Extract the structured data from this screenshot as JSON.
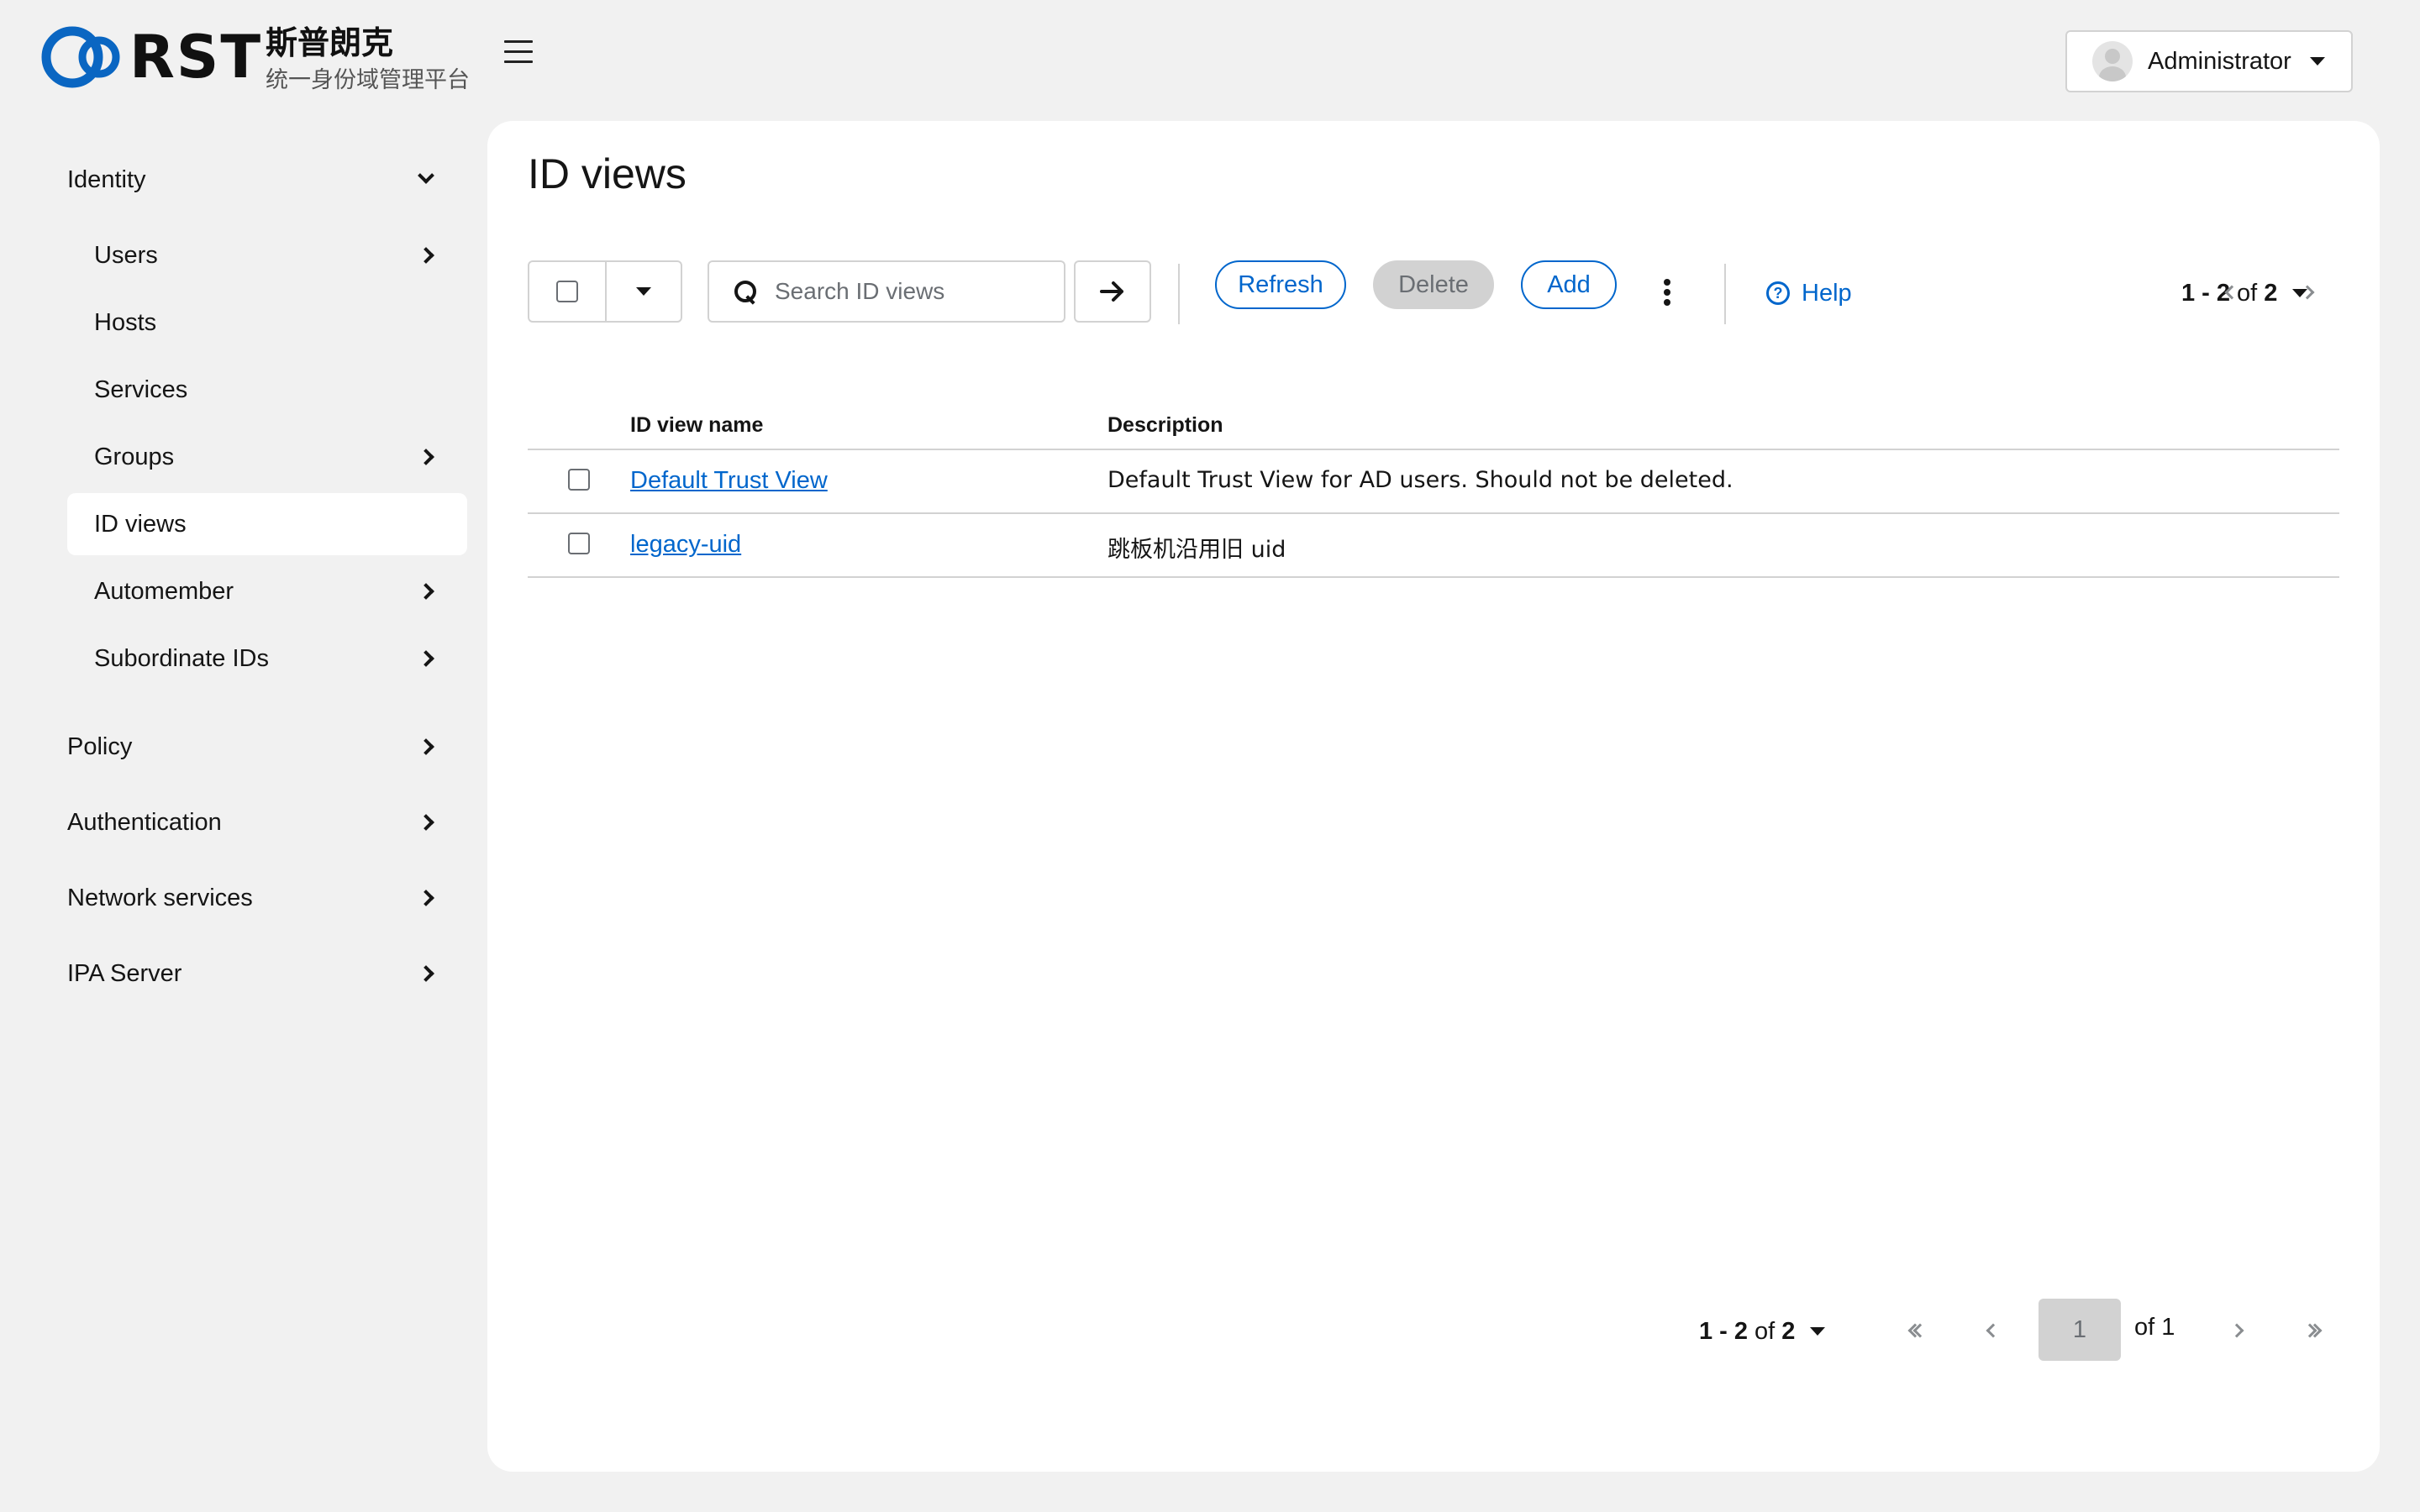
{
  "header": {
    "logo_text": "RST",
    "brand_name": "斯普朗克",
    "brand_subtitle": "统一身份域管理平台",
    "user": {
      "name": "Administrator"
    }
  },
  "sidebar": {
    "sections": [
      {
        "label": "Identity",
        "expanded": true
      },
      {
        "label": "Policy",
        "expanded": false
      },
      {
        "label": "Authentication",
        "expanded": false
      },
      {
        "label": "Network services",
        "expanded": false
      },
      {
        "label": "IPA Server",
        "expanded": false
      }
    ],
    "identity_items": [
      {
        "label": "Users",
        "has_children": true
      },
      {
        "label": "Hosts",
        "has_children": false
      },
      {
        "label": "Services",
        "has_children": false
      },
      {
        "label": "Groups",
        "has_children": true
      },
      {
        "label": "ID views",
        "has_children": false,
        "active": true
      },
      {
        "label": "Automember",
        "has_children": true
      },
      {
        "label": "Subordinate IDs",
        "has_children": true
      }
    ]
  },
  "main": {
    "title": "ID views",
    "toolbar": {
      "search_placeholder": "Search ID views",
      "refresh_label": "Refresh",
      "delete_label": "Delete",
      "add_label": "Add",
      "help_label": "Help",
      "pager_range": "1 - 2",
      "pager_of": "of",
      "pager_total": "2"
    },
    "table": {
      "columns": [
        "ID view name",
        "Description"
      ],
      "rows": [
        {
          "name": "Default Trust View",
          "description": "Default Trust View for AD users. Should not be deleted."
        },
        {
          "name": "legacy-uid",
          "description": "跳板机沿用旧 uid"
        }
      ]
    },
    "bottom_pager": {
      "range": "1 - 2",
      "of": "of",
      "total": "2",
      "current_page": "1",
      "of_pages": "of 1"
    }
  },
  "colors": {
    "link": "#0066cc",
    "logo_blue": "#0a66c2",
    "background": "#f1f1f1",
    "panel": "#ffffff"
  }
}
